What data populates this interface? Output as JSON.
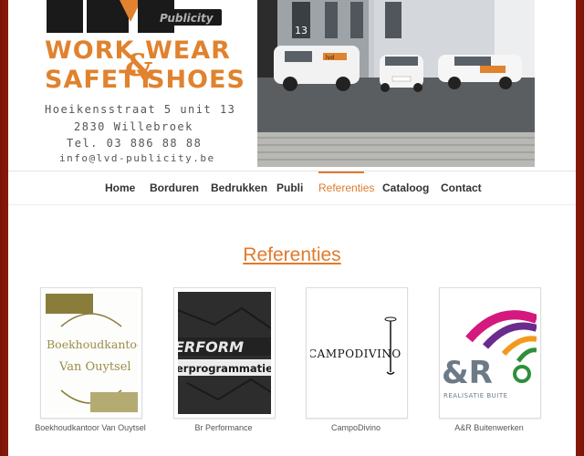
{
  "header": {
    "logo": {
      "mark": "LVD",
      "sub": "Publicity",
      "line1_a": "WORK",
      "amp": "&",
      "line1_b": "WEAR",
      "line2_a": "SAFETY",
      "line2_b": "SHOES"
    },
    "address": {
      "street": "Hoeikensstraat 5 unit 13",
      "city": "2830 Willebroek",
      "tel": "Tel. 03 886 88 88",
      "email": "info@lvd-publicity.be"
    },
    "photo": {
      "building_number": "13",
      "car_brand": "lvd"
    }
  },
  "nav": {
    "items": [
      {
        "label": "Home"
      },
      {
        "label": "Borduren"
      },
      {
        "label": "Bedrukken"
      },
      {
        "label": "Publi"
      },
      {
        "label": "Referenties",
        "active": true
      },
      {
        "label": "Cataloog"
      },
      {
        "label": "Contact"
      }
    ]
  },
  "section": {
    "title": "Referenties"
  },
  "references": [
    {
      "name": "Boekhoudkantoor Van Ouytsel",
      "logo_lines": [
        "Boekhoudkantoor",
        "Van Ouytsel"
      ]
    },
    {
      "name": "Br Performance",
      "logo_lines": [
        "ERFORM",
        "erprogrammatie"
      ]
    },
    {
      "name": "CampoDivino",
      "logo_lines": [
        "CAMPODIVINO"
      ]
    },
    {
      "name": "A&R Buitenwerken",
      "logo_lines": [
        "&R",
        "REALISATIE BUITE"
      ]
    }
  ],
  "colors": {
    "accent": "#e07a2d",
    "border": "#a2280c",
    "olive": "#9a8d4a",
    "magenta": "#d4187e"
  }
}
